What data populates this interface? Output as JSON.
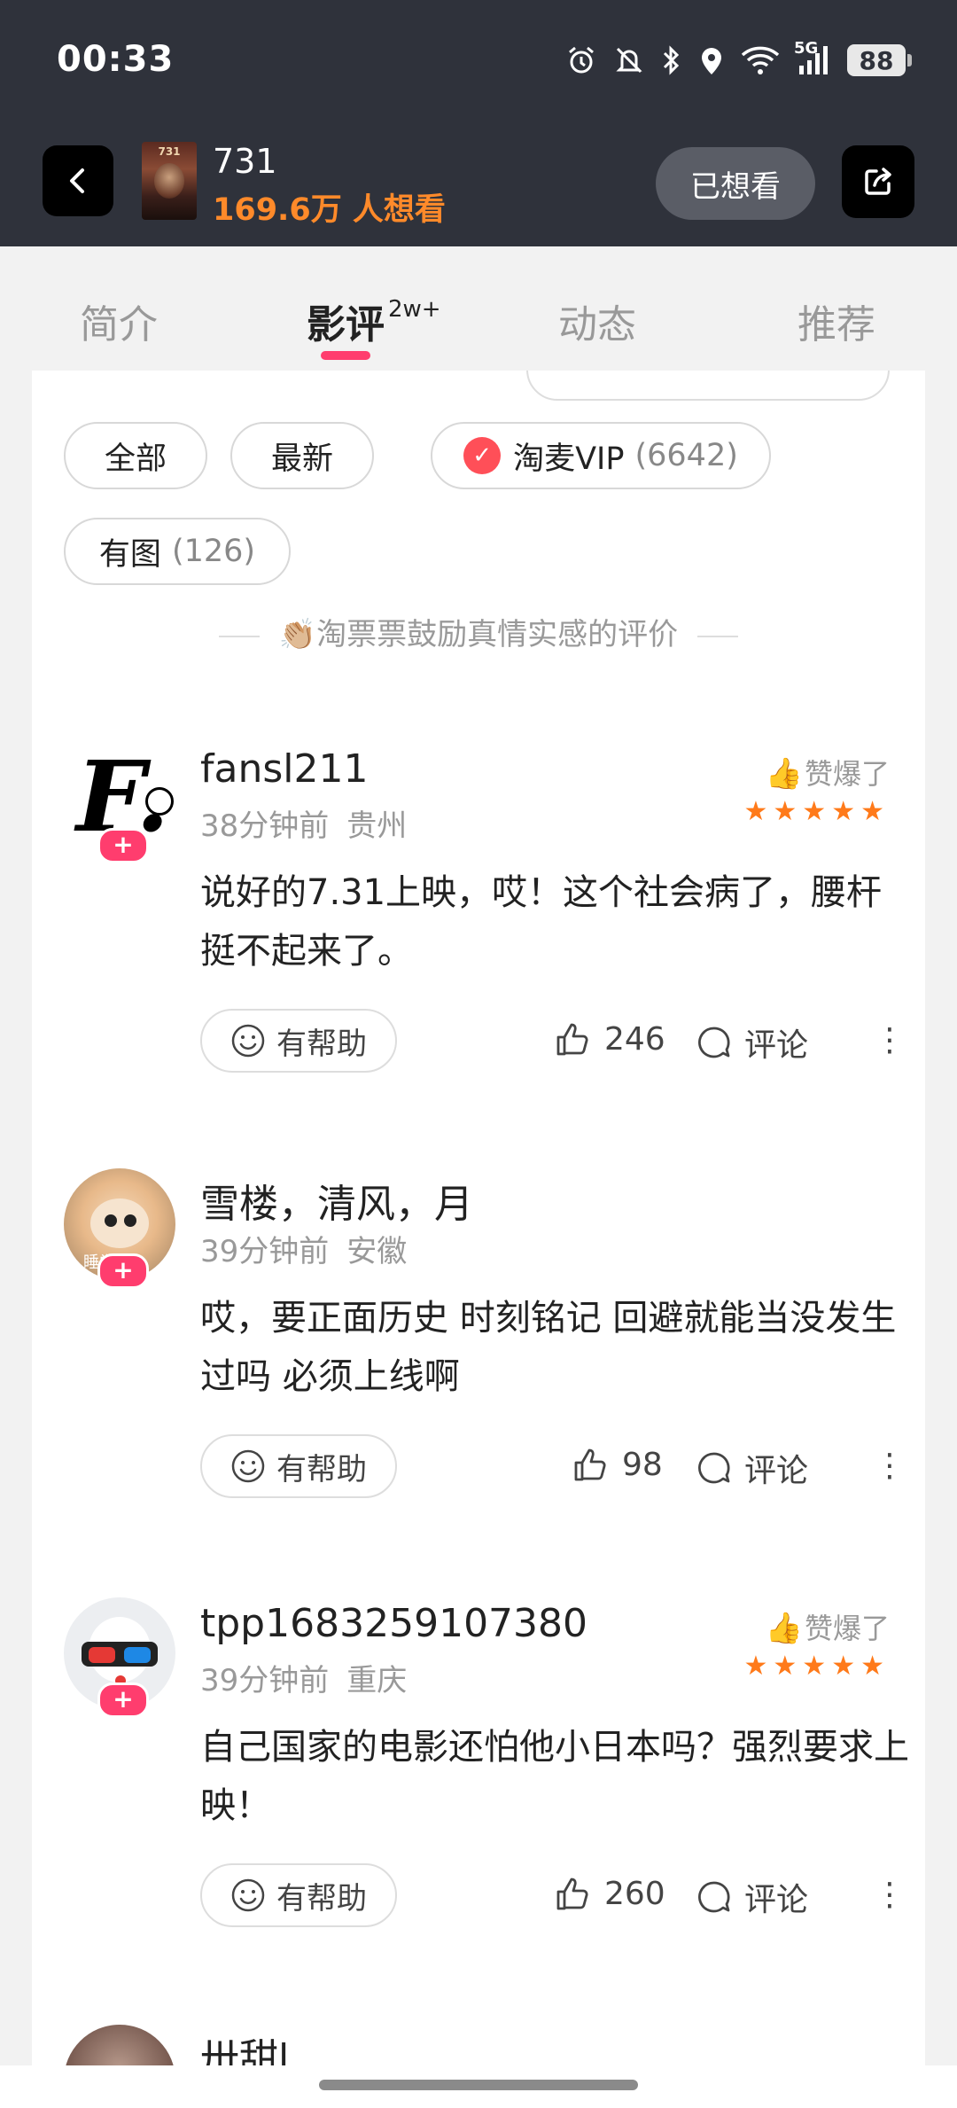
{
  "status_bar": {
    "time": "00:33",
    "network": "5G",
    "battery": "88"
  },
  "header": {
    "movie_title": "731",
    "poster_text": "731",
    "want_count": "169.6万 人想看",
    "wanted_label": "已想看"
  },
  "tabs": [
    {
      "label": "简介"
    },
    {
      "label": "影评",
      "badge": "2w+"
    },
    {
      "label": "动态"
    },
    {
      "label": "推荐"
    }
  ],
  "filters": {
    "all": "全部",
    "latest": "最新",
    "vip_logo": "✓",
    "vip": "淘麦VIP",
    "vip_count": "(6642)",
    "with_pic": "有图",
    "with_pic_count": "(126)"
  },
  "encourage_text": "👏🏼淘票票鼓励真情实感的评价",
  "reviews": [
    {
      "user": "fansl211",
      "time": "38分钟前",
      "location": "贵州",
      "praise": "赞爆了",
      "stars": "★★★★★",
      "content": "说好的7.31上映，哎！这个社会病了，腰杆挺不起来了。",
      "helpful": "有帮助",
      "likes": "246",
      "comment": "评论"
    },
    {
      "user": "雪楼，清风，月",
      "time": "39分钟前",
      "location": "安徽",
      "avatar_text": "睡觉中",
      "content": "哎，要正面历史 时刻铭记 回避就能当没发生过吗 必须上线啊",
      "helpful": "有帮助",
      "likes": "98",
      "comment": "评论"
    },
    {
      "user": "tpp1683259107380",
      "time": "39分钟前",
      "location": "重庆",
      "praise": "赞爆了",
      "stars": "★★★★★",
      "content": "自己国家的电影还怕他小日本吗？强烈要求上映！",
      "helpful": "有帮助",
      "likes": "260",
      "comment": "评论"
    }
  ],
  "partial_user": "卅甜l",
  "follow_plus": "+",
  "avatar_letter": "F.",
  "more_icon": "⋮",
  "icons": [
    "back-arrow-icon",
    "share-icon",
    "alarm-icon",
    "mute-icon",
    "bluetooth-icon",
    "location-icon",
    "wifi-icon",
    "signal-icon",
    "smile-icon",
    "thumb-up-icon",
    "comment-icon",
    "more-icon"
  ],
  "colors": {
    "header_bg": "#2f323b",
    "want_count": "#ff8a2a",
    "accent": "#ff3d6e",
    "stars": "#ff7a1a"
  }
}
